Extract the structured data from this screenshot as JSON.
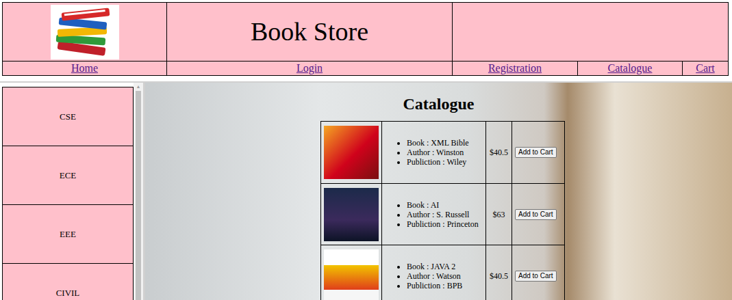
{
  "header": {
    "title": "Book Store"
  },
  "nav": [
    {
      "label": "Home"
    },
    {
      "label": "Login"
    },
    {
      "label": "Registration"
    },
    {
      "label": "Catalogue"
    },
    {
      "label": "Cart"
    }
  ],
  "sidebar": {
    "items": [
      "CSE",
      "ECE",
      "EEE",
      "CIVIL"
    ]
  },
  "catalogue": {
    "heading": "Catalogue",
    "books": [
      {
        "details": [
          "Book : XML Bible",
          "Author : Winston",
          "Publiction : Wiley"
        ],
        "price": "$40.5",
        "button": "Add to Cart"
      },
      {
        "details": [
          "Book : AI",
          "Author : S. Russell",
          "Publiction : Princeton"
        ],
        "price": "$63",
        "button": "Add to Cart"
      },
      {
        "details": [
          "Book : JAVA 2",
          "Author : Watson",
          "Publiction : BPB"
        ],
        "price": "$40.5",
        "button": "Add to Cart"
      }
    ]
  }
}
